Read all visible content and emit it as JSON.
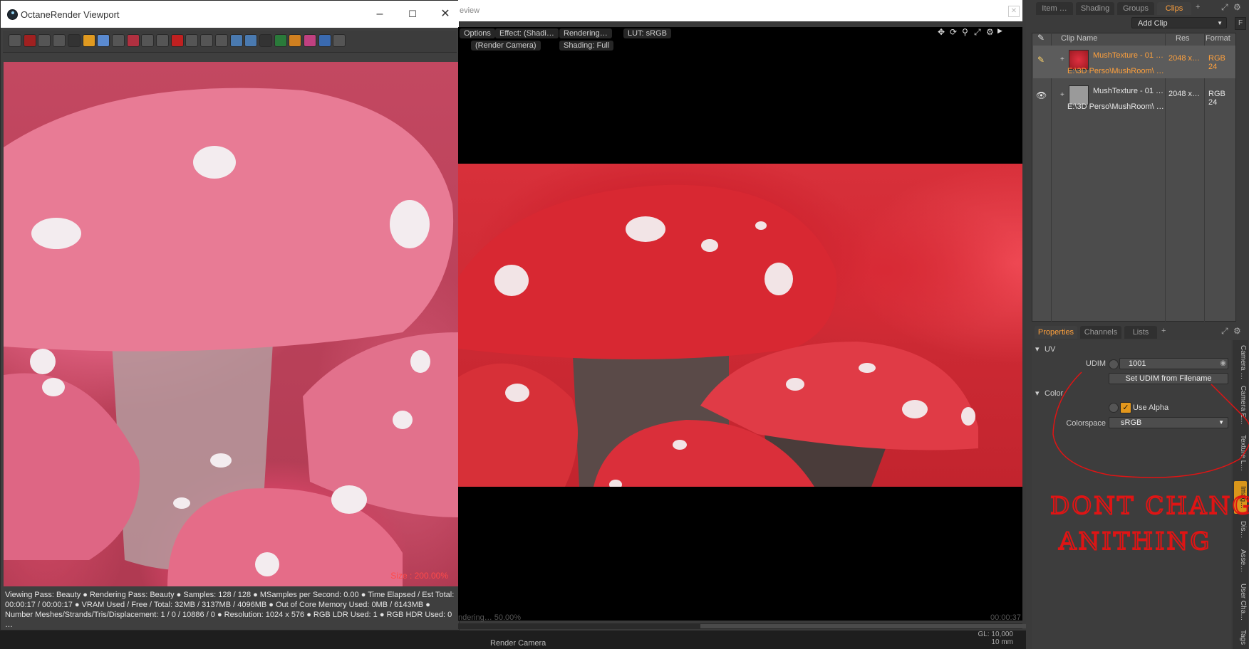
{
  "octane": {
    "title": "OctaneRender Viewport",
    "size_label": "Size : 200.00%",
    "status_lines": [
      "Viewing Pass: Beauty ●  Rendering Pass: Beauty ●  Samples: 128  / 128 ●  MSamples per Second: 0.00 ●  Time Elapsed / Est Total:",
      "00:00:17 / 00:00:17 ●  VRAM Used / Free / Total: 32MB / 3137MB / 4096MB ●  Out of Core Memory Used: 0MB / 6143MB ●",
      "Number Meshes/Strands/Tris/Displacement: 1 / 0 / 10886 / 0 ●  Resolution: 1024 x 576 ●  RGB LDR Used: 1 ●  RGB HDR Used: 0 …"
    ],
    "toolbar_icons": [
      "fit-icon",
      "stop-render-icon",
      "pause-icon",
      "restart-icon",
      "stop-icon",
      "af-icon",
      "color-picker-icon",
      "focus-icon",
      "region-icon",
      "film-region-icon",
      "save-icon",
      "clear-icon",
      "settings-icon",
      "snapshot-icon",
      "camera-icon",
      "cube-icon",
      "cloud-icon",
      "terminal-icon",
      "layers-icon",
      "mix-icon",
      "palette-icon",
      "world-icon",
      "document-icon"
    ]
  },
  "modo_view": {
    "title_partial": "eview",
    "options": "Options",
    "effect": "Effect: (Shadi…",
    "rendering": "Rendering…",
    "lut": "LUT: sRGB",
    "camera": "(Render Camera)",
    "shading": "Shading: Full",
    "foot_left": "ndering… 50.00%",
    "foot_right": "00:00:37",
    "bottom_camera": "Render Camera",
    "gl_line1": "GL: 10,000",
    "gl_line2": "10 mm"
  },
  "clips_panel": {
    "tabs": [
      "Item …",
      "Shading",
      "Groups",
      "Clips"
    ],
    "active_tab": "Clips",
    "add_clip": "Add Clip",
    "columns": {
      "name": "Clip Name",
      "res": "Res",
      "format": "Format"
    },
    "rows": [
      {
        "name": "MushTexture - 01 …",
        "path": "E:\\3D Perso\\MushRoom\\ …",
        "res": "2048 x…",
        "format": "RGB 24",
        "selected": true
      },
      {
        "name": "MushTexture - 01 …",
        "path": "E:\\3D Perso\\MushRoom\\ …",
        "res": "2048 x…",
        "format": "RGB 24",
        "selected": false
      }
    ]
  },
  "properties": {
    "tabs": [
      "Properties",
      "Channels",
      "Lists"
    ],
    "active_tab": "Properties",
    "uv_section": "UV",
    "udim_label": "UDIM",
    "udim_value": "1001",
    "set_udim_button": "Set UDIM from Filename",
    "color_section": "Color",
    "use_alpha_label": "Use Alpha",
    "use_alpha_checked": true,
    "colorspace_label": "Colorspace",
    "colorspace_value": "sRGB",
    "side_tabs": [
      "Camera …",
      "Camera E…",
      "Texture L…",
      "Imag…",
      "Dis…",
      "Asse…",
      "User Cha…",
      "Tags"
    ],
    "active_side_tab": "Imag…"
  },
  "annotation": {
    "line1": "DONT CHANGE",
    "line2": "ANITHING"
  },
  "colors": {
    "accent": "#ffa13d",
    "annotation_red": "#e01414",
    "octane_size_red": "#ff4a4a"
  }
}
